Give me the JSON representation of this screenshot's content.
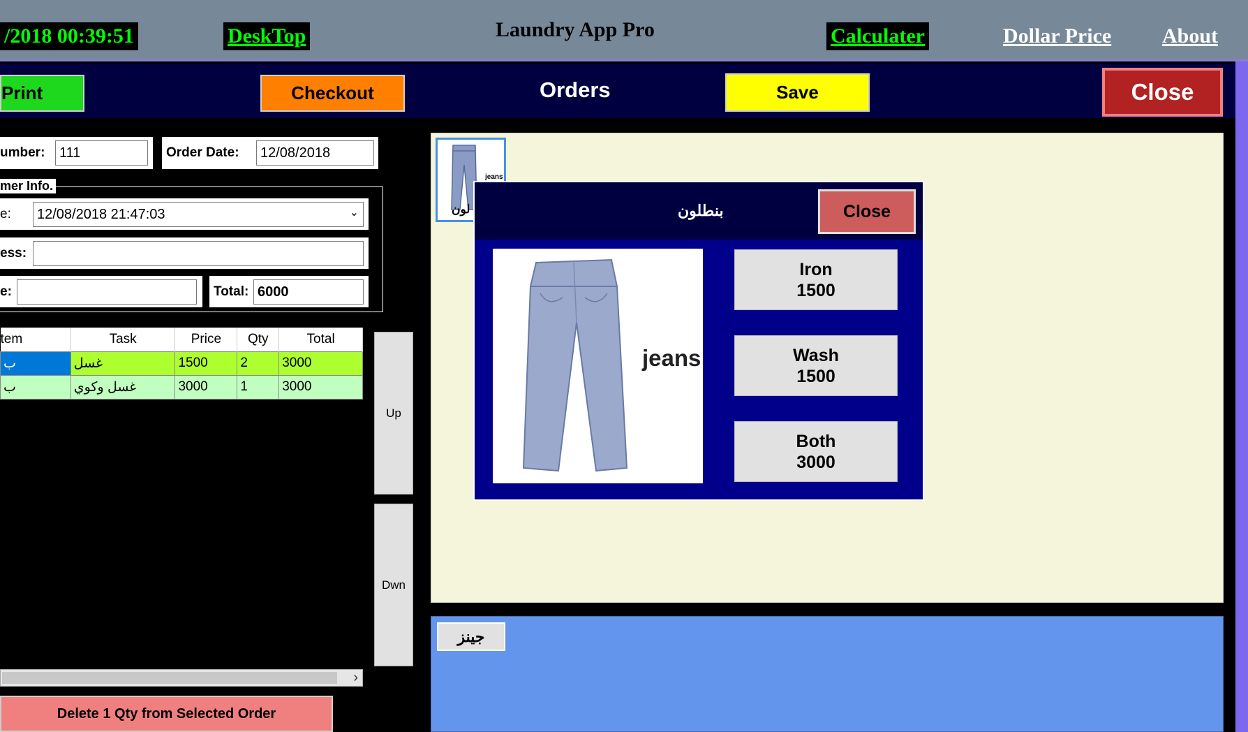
{
  "topbar": {
    "clock": "/2018 00:39:51",
    "desktop_link": "DeskTop",
    "title": "Laundry App Pro",
    "calculator_link": "Calculater",
    "dollar_link": "Dollar Price",
    "about_link": "About"
  },
  "toolbar": {
    "print_label": "Print",
    "checkout_label": "Checkout",
    "heading": "Orders",
    "save_label": "Save",
    "close_label": "Close"
  },
  "order": {
    "number_label": "umber:",
    "number_value": "111",
    "date_label": "Order Date:",
    "date_value": "12/08/2018",
    "customer_group_label": "mer Info.",
    "time_label": "e:",
    "time_value": "12/08/2018 21:47:03",
    "address_label": "ess:",
    "address_value": "",
    "phone_label": "e:",
    "phone_value": "",
    "total_label": "Total:",
    "total_value": "6000"
  },
  "grid": {
    "columns": [
      "tem",
      "Task",
      "Price",
      "Qty",
      "Total"
    ],
    "rows": [
      {
        "item": "ب",
        "task": "غسل",
        "price": "1500",
        "qty": "2",
        "total": "3000"
      },
      {
        "item": "ب",
        "task": "غسل وكوي",
        "price": "3000",
        "qty": "1",
        "total": "3000"
      }
    ],
    "scroll_right": "›"
  },
  "side": {
    "up_label": "Up",
    "down_label": "Dwn"
  },
  "delete_label": "Delete 1 Qty from Selected Order",
  "thumb": {
    "caption": "jeans",
    "label": "لون"
  },
  "popup": {
    "title": "بنطلون",
    "close_label": "Close",
    "image_caption": "jeans",
    "options": [
      {
        "name": "Iron",
        "price": "1500"
      },
      {
        "name": "Wash",
        "price": "1500"
      },
      {
        "name": "Both",
        "price": "3000"
      }
    ]
  },
  "category": {
    "button_label": "جينز"
  },
  "colors": {
    "topbar": "#778899",
    "toolbar": "#000040",
    "print": "#1ed81e",
    "checkout": "#ff7f00",
    "save": "#ffff00",
    "close": "#b22222",
    "popup_bg": "#00008b",
    "popup_close": "#cd5c5c",
    "panel": "#f5f5dc",
    "category_panel": "#6495ed",
    "delete": "#f08080"
  }
}
